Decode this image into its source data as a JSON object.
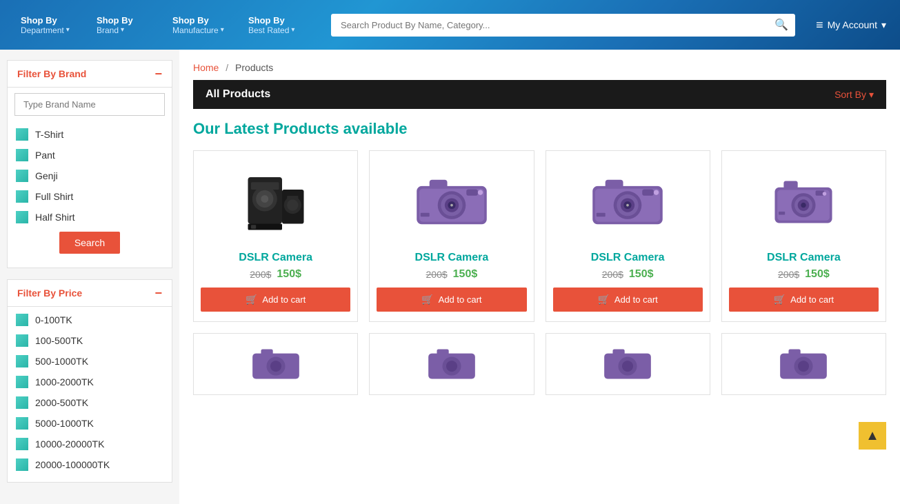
{
  "header": {
    "nav_items": [
      {
        "shop_by": "Shop By",
        "sub": "Department",
        "id": "department"
      },
      {
        "shop_by": "Shop By",
        "sub": "Brand",
        "id": "brand"
      },
      {
        "shop_by": "Shop By",
        "sub": "Manufacture",
        "id": "manufacture"
      },
      {
        "shop_by": "Shop By",
        "sub": "Best Rated",
        "id": "best-rated"
      }
    ],
    "search_placeholder": "Search Product By Name, Category...",
    "my_account_label": "My Account",
    "my_account_icon": "≡"
  },
  "sidebar": {
    "filter_brand": {
      "title": "Filter By Brand",
      "minus": "−",
      "input_placeholder": "Type Brand Name",
      "items": [
        {
          "label": "T-Shirt"
        },
        {
          "label": "Pant"
        },
        {
          "label": "Genji"
        },
        {
          "label": "Full Shirt"
        },
        {
          "label": "Half Shirt"
        }
      ],
      "search_btn": "Search"
    },
    "filter_price": {
      "title": "Filter By Price",
      "minus": "−",
      "items": [
        {
          "label": "0-100TK"
        },
        {
          "label": "100-500TK"
        },
        {
          "label": "500-1000TK"
        },
        {
          "label": "1000-2000TK"
        },
        {
          "label": "2000-500TK"
        },
        {
          "label": "5000-1000TK"
        },
        {
          "label": "10000-20000TK"
        },
        {
          "label": "20000-100000TK"
        }
      ]
    }
  },
  "content": {
    "breadcrumb": {
      "home": "Home",
      "separator": "/",
      "current": "Products"
    },
    "all_products_title": "All Products",
    "sort_by_label": "Sort By",
    "latest_title": "Our Latest Products available",
    "products": [
      {
        "name": "DSLR Camera",
        "price_old": "200$",
        "price_new": "150$",
        "type": "speaker",
        "add_btn": "Add to cart"
      },
      {
        "name": "DSLR Camera",
        "price_old": "200$",
        "price_new": "150$",
        "type": "camera",
        "add_btn": "Add to cart"
      },
      {
        "name": "DSLR Camera",
        "price_old": "200$",
        "price_new": "150$",
        "type": "camera",
        "add_btn": "Add to cart"
      },
      {
        "name": "DSLR Camera",
        "price_old": "200$",
        "price_new": "150$",
        "type": "camera-small",
        "add_btn": "Add to cart"
      }
    ],
    "second_row_products": [
      {
        "type": "camera"
      },
      {
        "type": "camera"
      },
      {
        "type": "camera"
      },
      {
        "type": "camera"
      }
    ]
  },
  "scroll_top": "▲"
}
